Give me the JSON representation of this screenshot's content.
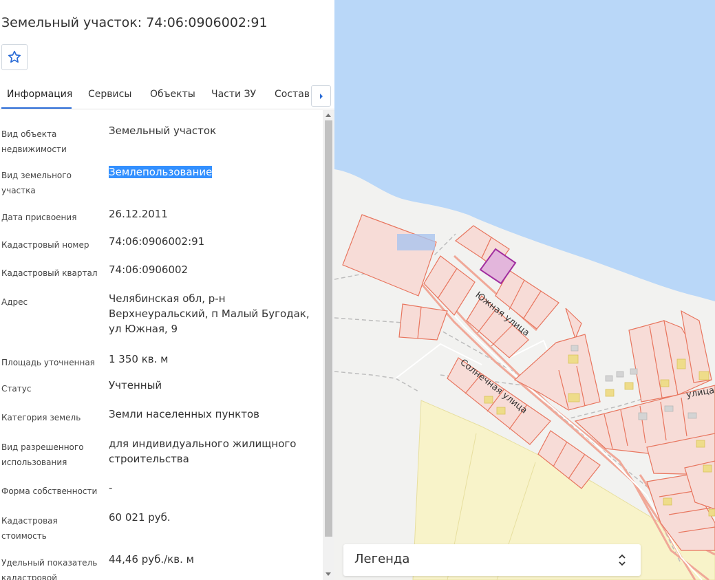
{
  "header": {
    "breadcrumb": "·· ·· ·· ·· ··",
    "title": "Земельный участок: 74:06:0906002:91"
  },
  "tabs": [
    {
      "label": "Информация",
      "active": true
    },
    {
      "label": "Сервисы",
      "active": false
    },
    {
      "label": "Объекты",
      "active": false
    },
    {
      "label": "Части ЗУ",
      "active": false
    },
    {
      "label": "Состав",
      "active": false
    }
  ],
  "info": [
    {
      "label": "Вид объекта недвижимости",
      "value": "Земельный участок"
    },
    {
      "label": "Вид земельного участка",
      "value": "Землепользование",
      "selected": true
    },
    {
      "label": "Дата присвоения",
      "value": "26.12.2011"
    },
    {
      "label": "Кадастровый номер",
      "value": "74:06:0906002:91"
    },
    {
      "label": "Кадастровый квартал",
      "value": "74:06:0906002"
    },
    {
      "label": "Адрес",
      "value": "Челябинская обл, р-н Верхнеуральский, п Малый Бугодак, ул Южная, 9"
    },
    {
      "label": "Площадь уточненная",
      "value": "1 350 кв. м"
    },
    {
      "label": "Статус",
      "value": "Учтенный"
    },
    {
      "label": "Категория земель",
      "value": "Земли населенных пунктов"
    },
    {
      "label": "Вид разрешенного использования",
      "value": "для индивидуального жилищного строительства"
    },
    {
      "label": "Форма собственности",
      "value": "-"
    },
    {
      "label": "Кадастровая стоимость",
      "value": "60 021 руб."
    },
    {
      "label": "Удельный показатель кадастровой стоимости",
      "value": "44,46 руб./кв. м"
    }
  ],
  "map": {
    "streets": [
      "Южная улица",
      "Солнечная улица",
      "улица"
    ],
    "legend_label": "Легенда"
  },
  "icons": [
    "star-icon",
    "chevron-right-icon",
    "chevron-updown-icon"
  ],
  "colors": {
    "accent": "#2a6bd6",
    "selection": "#3390ff",
    "water": "#b9d7f8",
    "parcel_fill": "#f7dcd7",
    "parcel_stroke": "#e8765f",
    "selected_parcel": "#a12fa0",
    "farmland": "#f8f3c9"
  }
}
